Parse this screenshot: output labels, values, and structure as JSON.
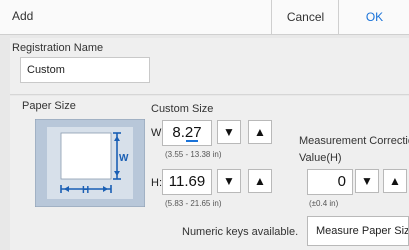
{
  "header": {
    "title": "Add",
    "cancel_label": "Cancel",
    "ok_label": "OK"
  },
  "registration": {
    "label": "Registration Name",
    "value": "Custom"
  },
  "paper_size": {
    "label": "Paper Size",
    "w_symbol": "W",
    "h_symbol": "H"
  },
  "custom_size": {
    "label": "Custom Size",
    "width": {
      "label": "W:",
      "value": "8.27",
      "range": "(3.55 - 13.38 in)"
    },
    "height": {
      "label": "H:",
      "value": "11.69",
      "range": "(5.83 - 21.65 in)"
    },
    "down_glyph": "▼",
    "up_glyph": "▲"
  },
  "measurement": {
    "label": "Measurement Correction",
    "value_label": "Value(H)",
    "value": "0",
    "range": "(±0.4 in)"
  },
  "numeric_note": "Numeric keys available.",
  "measure_button_label": "Measure Paper Size",
  "colors": {
    "accent": "#1a73d9",
    "panel": "#efefef",
    "diagram_frame": "#b8c7d9"
  },
  "icons": [
    "paper-size-diagram-icon",
    "decrement-arrow-icon",
    "increment-arrow-icon"
  ]
}
